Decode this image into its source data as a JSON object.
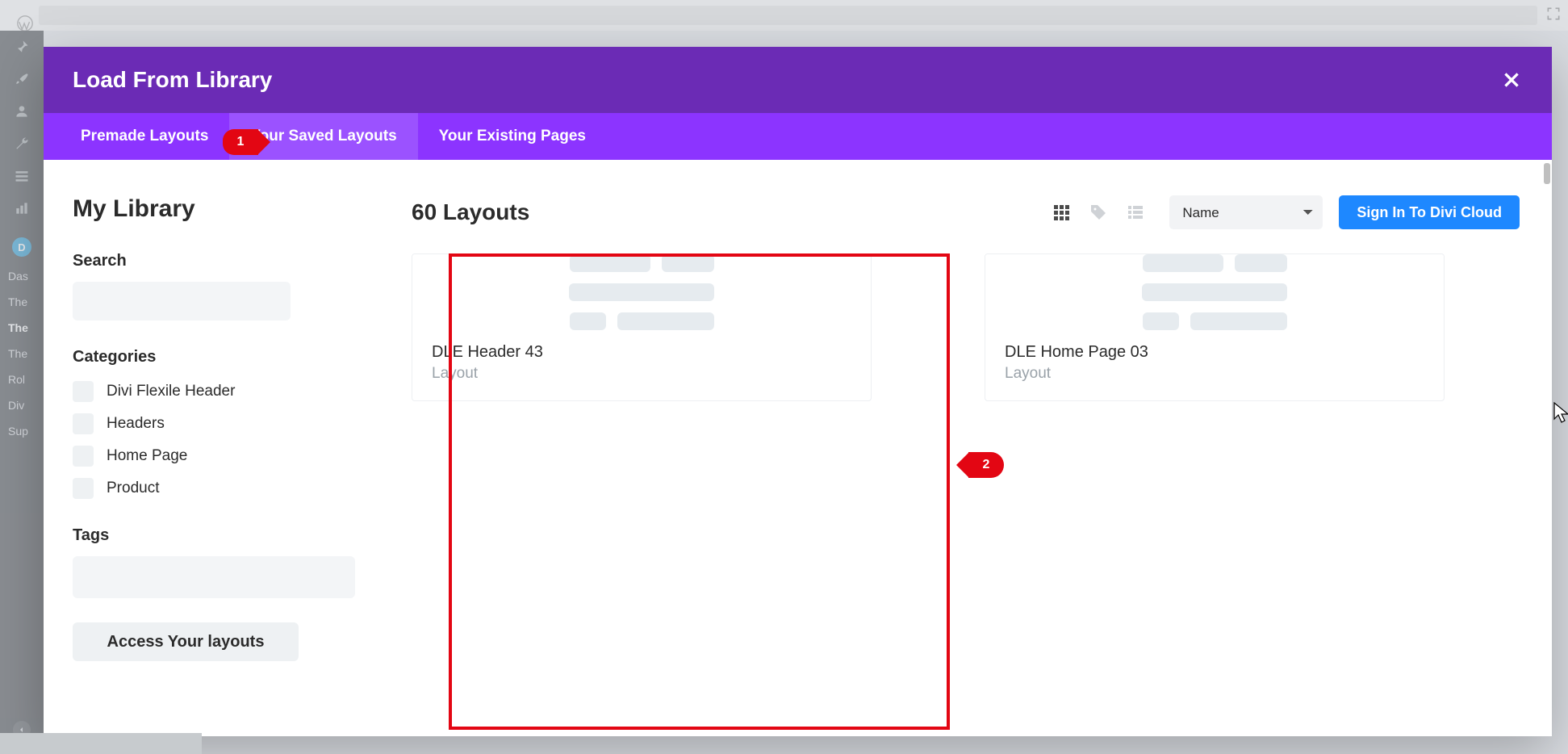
{
  "wp_sidebar": {
    "items": [
      "Das",
      "The",
      "The",
      "The",
      "Rol",
      "Div",
      "Sup"
    ],
    "active_index": 2,
    "divi_initial": "D"
  },
  "modal": {
    "title": "Load From Library",
    "tabs": {
      "premade": "Premade Layouts",
      "saved": "Your Saved Layouts",
      "existing": "Your Existing Pages",
      "active": "saved"
    },
    "step1": "1",
    "step2": "2",
    "filters": {
      "heading": "My Library",
      "search_label": "Search",
      "search_value": "",
      "categories_label": "Categories",
      "categories": [
        "Divi Flexile Header",
        "Headers",
        "Home Page",
        "Product"
      ],
      "tags_label": "Tags",
      "access_button": "Access Your layouts"
    },
    "content": {
      "count_label": "60 Layouts",
      "sort_label": "Name",
      "signin_label": "Sign In To Divi Cloud",
      "cards": [
        {
          "title": "DLE Header 43",
          "type": "Layout"
        },
        {
          "title": "DLE Home Page 03",
          "type": "Layout"
        }
      ]
    },
    "views": {
      "grid": "grid",
      "tag": "tag",
      "list": "list"
    }
  }
}
